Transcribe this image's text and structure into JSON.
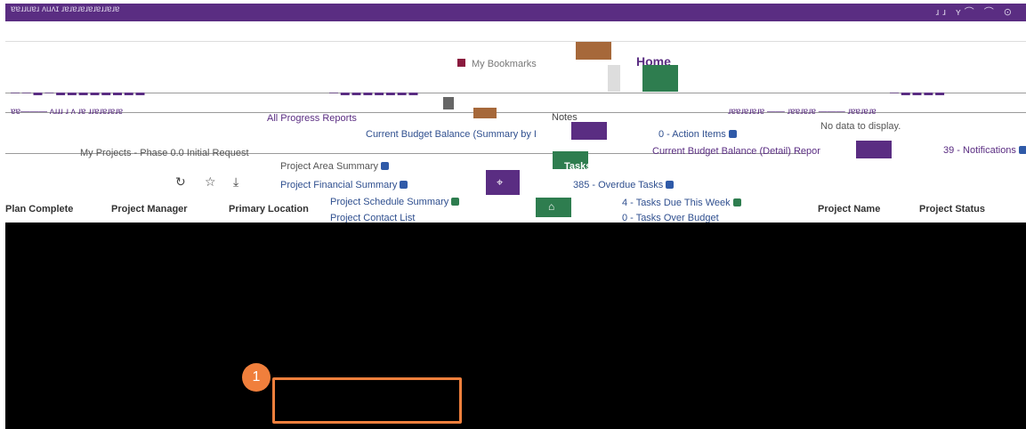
{
  "topbar": {
    "text": "ɐɐɹɹuɐɹ ʌuʌɪ ɹɐɹɐɹɐɹɐɹɐɹɹɐɹɐ",
    "right": "ɹɹ ʏ⌒ ⌒ ⊙"
  },
  "nav": {
    "my_bookmarks": "My Bookmarks",
    "home": "Home"
  },
  "row3": {
    "left": "— — ▬ — ▬ ▬ ▬ ▬ ▬ ▬ ▬ ▬",
    "middle": "— ▬ ▬ ▬ ▬ ▬ ▬ ▬",
    "right": "— ▬ ▬ ▬ ▬"
  },
  "row4": {
    "left": "ɐɐ——— ʌɹɹɹ ɹ  ʌ ɹɐ ɹɹɐɹɐɹɐɹɐ",
    "middle": "All Progress Reports",
    "notes": "Notes",
    "right": "ɹɐɐɹɐɹɐɹɐ —— ɹɐɐɹɐɹɐ ——— ɹɐɐɹɐɹɐ"
  },
  "widgets": {
    "no_data": "No data to display.",
    "current_budget_summary": "Current Budget Balance (Summary by I",
    "action_items": "0 - Action Items",
    "my_projects": "My Projects - Phase 0.0 Initial Request",
    "current_budget_detail": "Current Budget Balance (Detail) Repor",
    "notifications": "39 - Notifications",
    "project_area_summary": "Project Area Summary",
    "tasks": "Tasks",
    "project_financial_summary": "Project Financial Summary",
    "overdue_tasks": "385 - Overdue Tasks",
    "project_schedule_summary": "Project Schedule Summary",
    "tasks_due_this_week": "4 - Tasks Due This Week",
    "project_contact_list": "Project Contact List",
    "tasks_over_budget": "0 - Tasks Over Budget"
  },
  "toolbar": {
    "refresh_icon": "↻",
    "star_icon": "☆",
    "download_icon": "⤓"
  },
  "table_headers": {
    "plan_complete": "Plan Complete",
    "project_manager": "Project Manager",
    "primary_location": "Primary Location",
    "project_name": "Project Name",
    "project_status": "Project Status"
  },
  "callout": {
    "number": "1"
  },
  "colors": {
    "topbar": "#5a2d82",
    "accent_green": "#2e7d4f",
    "link": "#2f4f8f",
    "callout": "#f07f3c"
  }
}
